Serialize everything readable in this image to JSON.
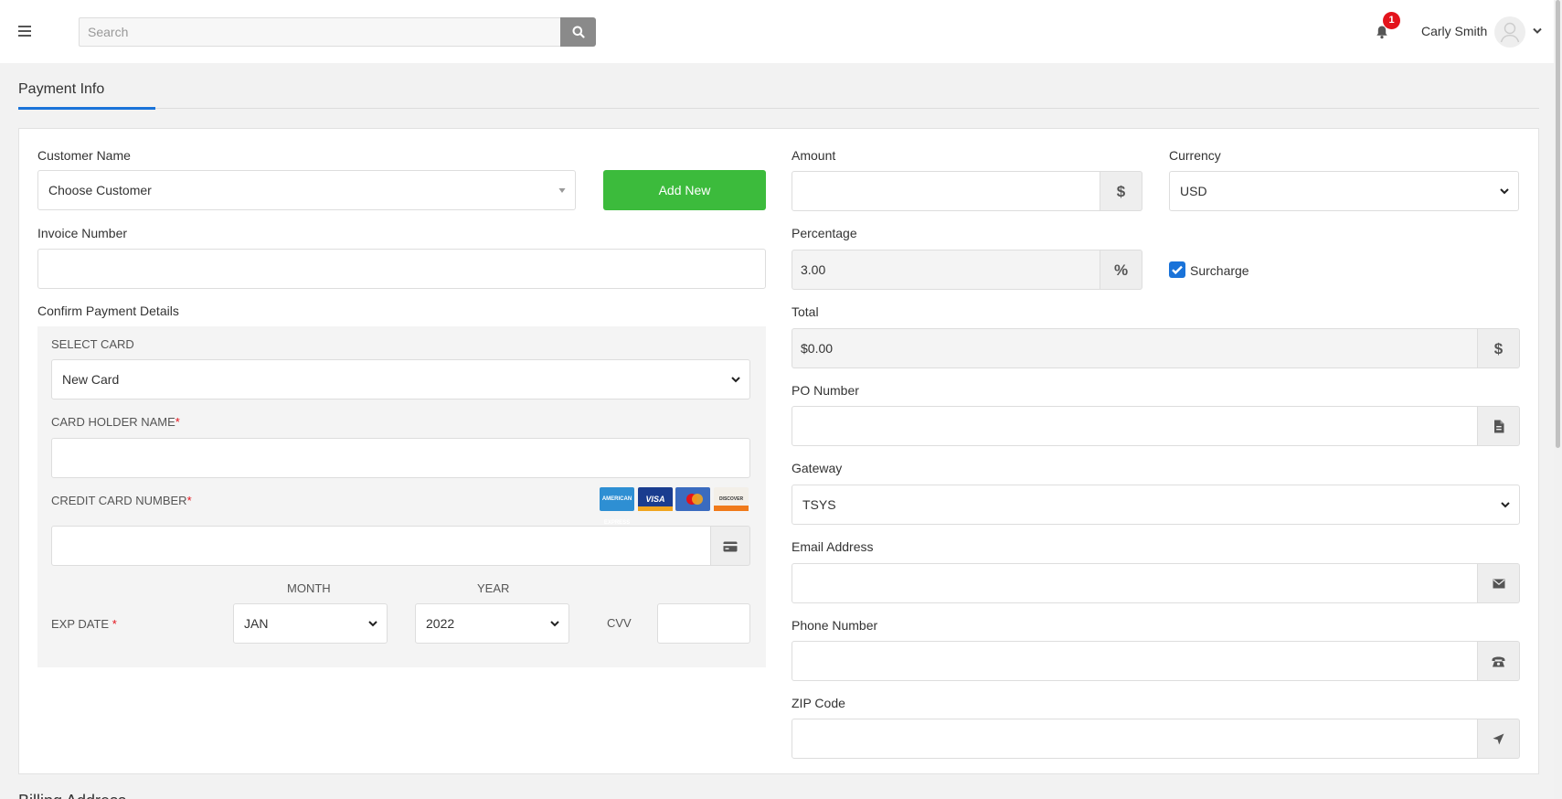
{
  "header": {
    "search_placeholder": "Search",
    "notification_count": "1",
    "user_name": "Carly Smith"
  },
  "tab": {
    "label": "Payment Info"
  },
  "form": {
    "customer_name_label": "Customer Name",
    "customer_select_value": "Choose Customer",
    "add_new_label": "Add New",
    "invoice_number_label": "Invoice Number",
    "invoice_number_value": "",
    "confirm_payment_label": "Confirm Payment Details",
    "select_card_label": "SELECT CARD",
    "select_card_value": "New Card",
    "card_holder_label": "CARD HOLDER NAME",
    "card_holder_value": "",
    "credit_card_label": "CREDIT CARD NUMBER",
    "credit_card_value": "",
    "card_logos": [
      "AMERICAN EXPRESS",
      "VISA",
      "MASTERCARD",
      "DISCOVER"
    ],
    "month_label": "MONTH",
    "year_label": "YEAR",
    "exp_date_label": "EXP DATE",
    "month_value": "JAN",
    "year_value": "2022",
    "cvv_label": "CVV",
    "cvv_value": "",
    "amount_label": "Amount",
    "amount_value": "",
    "amount_addon": "$",
    "currency_label": "Currency",
    "currency_value": "USD",
    "percentage_label": "Percentage",
    "percentage_value": "3.00",
    "percentage_addon": "%",
    "surcharge_label": "Surcharge",
    "surcharge_checked": true,
    "total_label": "Total",
    "total_value": "$0.00",
    "total_addon": "$",
    "po_number_label": "PO Number",
    "po_number_value": "",
    "gateway_label": "Gateway",
    "gateway_value": "TSYS",
    "email_label": "Email Address",
    "email_value": "",
    "phone_label": "Phone Number",
    "phone_value": "",
    "zip_label": "ZIP Code",
    "zip_value": ""
  },
  "next_section_heading": "Billing Address",
  "colors": {
    "accent": "#1a73d9",
    "add_button": "#3cbb3c",
    "badge": "#e3131b",
    "required": "#e3131b"
  },
  "icons": [
    "menu-icon",
    "search-icon",
    "bell-icon",
    "avatar-icon",
    "chevron-down-icon",
    "credit-card-icon",
    "document-icon",
    "envelope-icon",
    "phone-icon",
    "location-arrow-icon"
  ]
}
